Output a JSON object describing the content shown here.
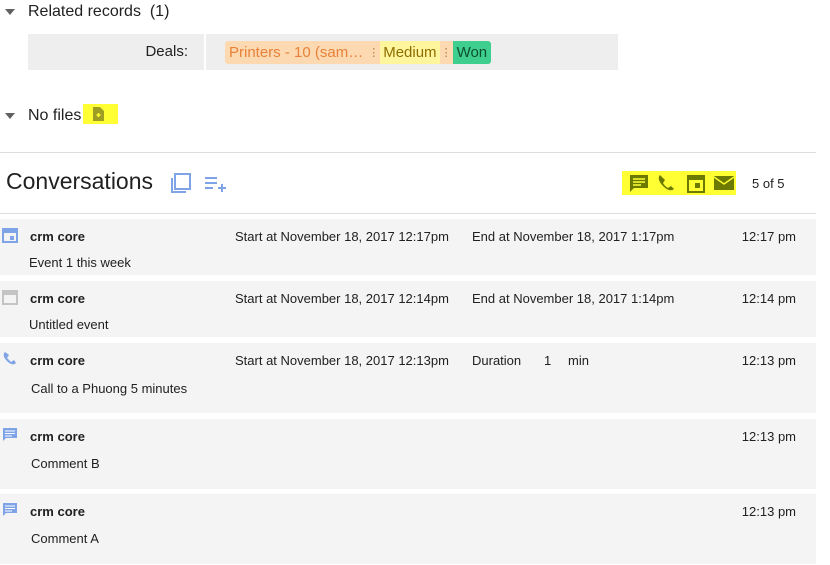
{
  "related": {
    "title": "Related records",
    "count": "(1)"
  },
  "deals": {
    "label": "Deals:",
    "chip_name": "Printers - 10 (sam…",
    "dots": "⋮",
    "stage": "Medium",
    "status": "Won"
  },
  "files": {
    "title": "No files"
  },
  "conversations": {
    "title": "Conversations",
    "counter": "5 of 5",
    "rows": [
      {
        "icon": "calendar-icon",
        "who": "crm core",
        "c1": "Start at November 18, 2017 12:17pm",
        "c2": "End at November 18, 2017 1:17pm",
        "time": "12:17 pm",
        "desc": "Event 1 this week"
      },
      {
        "icon": "calendar-icon",
        "who": "crm core",
        "c1": "Start at November 18, 2017 12:14pm",
        "c2": "End at November 18, 2017 1:14pm",
        "time": "12:14 pm",
        "desc": "Untitled event"
      },
      {
        "icon": "phone-icon",
        "who": "crm core",
        "c1": "Start at November 18, 2017 12:13pm",
        "c2_label": "Duration",
        "c2_value": "1",
        "c2_unit": "min",
        "time": "12:13 pm",
        "desc": "Call to a Phuong 5 minutes"
      },
      {
        "icon": "comment-icon",
        "who": "crm core",
        "time": "12:13 pm",
        "desc": "Comment B"
      },
      {
        "icon": "comment-icon",
        "who": "crm core",
        "time": "12:13 pm",
        "desc": "Comment A"
      }
    ]
  },
  "colors": {
    "accent": "#7ea3e6",
    "highlight": "#ffff33",
    "row_bg": "#f4f4f4",
    "chip_bg": "#fcd9b0",
    "won": "#3ecf8e",
    "medium": "#fff59d"
  }
}
